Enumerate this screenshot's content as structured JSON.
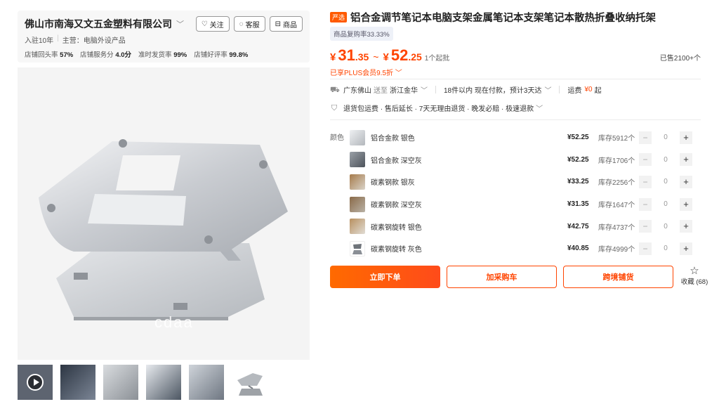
{
  "shop": {
    "name": "佛山市南海又文五金塑料有限公司",
    "follow_label": "关注",
    "service_label": "客服",
    "goods_label": "商品",
    "years": "入驻10年",
    "main_business": "主营：电脑外设产品",
    "stats": [
      {
        "label": "店铺回头率",
        "value": "57%"
      },
      {
        "label": "店铺服务分",
        "value": "4.0分"
      },
      {
        "label": "准时发货率",
        "value": "99%"
      },
      {
        "label": "店铺好评率",
        "value": "99.8%"
      }
    ]
  },
  "gallery": {
    "watermark": "cdaa",
    "thumbnails": [
      "video-thumb",
      "thumb-2",
      "thumb-3",
      "thumb-4",
      "thumb-5",
      "thumb-6"
    ]
  },
  "product": {
    "tag": "严选",
    "title": "铝合金调节笔记本电脑支架金属笔记本支架笔记本散热折叠收纳托架",
    "repurchase": "商品复购率33.33%",
    "price_min_int": "31",
    "price_min_dec": ".35",
    "price_max_int": "52",
    "price_max_dec": ".25",
    "currency": "¥",
    "min_order": "1个起批",
    "sold": "已售2100+个",
    "plus": "已享PLUS会员9.5折 ﹀"
  },
  "shipping": {
    "from": "广东佛山",
    "to_label": "送至",
    "to": "浙江金华",
    "timing": "18件以内  现在付款，预计3天达",
    "fee_label": "运费",
    "fee_value": "¥0",
    "fee_suffix": "起"
  },
  "services": "退货包运费 · 售后延长 · 7天无理由退货 · 晚发必赔 · 极速退款",
  "sku": {
    "label": "颜色",
    "items": [
      {
        "name": "铝合金款 银色",
        "price": "¥52.25",
        "stock": "库存5912个",
        "qty": "0"
      },
      {
        "name": "铝合金款 深空灰",
        "price": "¥52.25",
        "stock": "库存1706个",
        "qty": "0"
      },
      {
        "name": "碳素钢款 银灰",
        "price": "¥33.25",
        "stock": "库存2256个",
        "qty": "0"
      },
      {
        "name": "碳素钢款 深空灰",
        "price": "¥31.35",
        "stock": "库存1647个",
        "qty": "0"
      },
      {
        "name": "碳素钢旋转 银色",
        "price": "¥42.75",
        "stock": "库存4737个",
        "qty": "0"
      },
      {
        "name": "碳素钢旋转 灰色",
        "price": "¥40.85",
        "stock": "库存4999个",
        "qty": "0"
      }
    ]
  },
  "actions": {
    "buy_now": "立即下单",
    "add_cart": "加采购车",
    "cross_border": "跨境铺货",
    "favorite": "收藏 (68)"
  },
  "colors": {
    "accent": "#ff4400",
    "primary_gradient_start": "#ff6a00"
  }
}
